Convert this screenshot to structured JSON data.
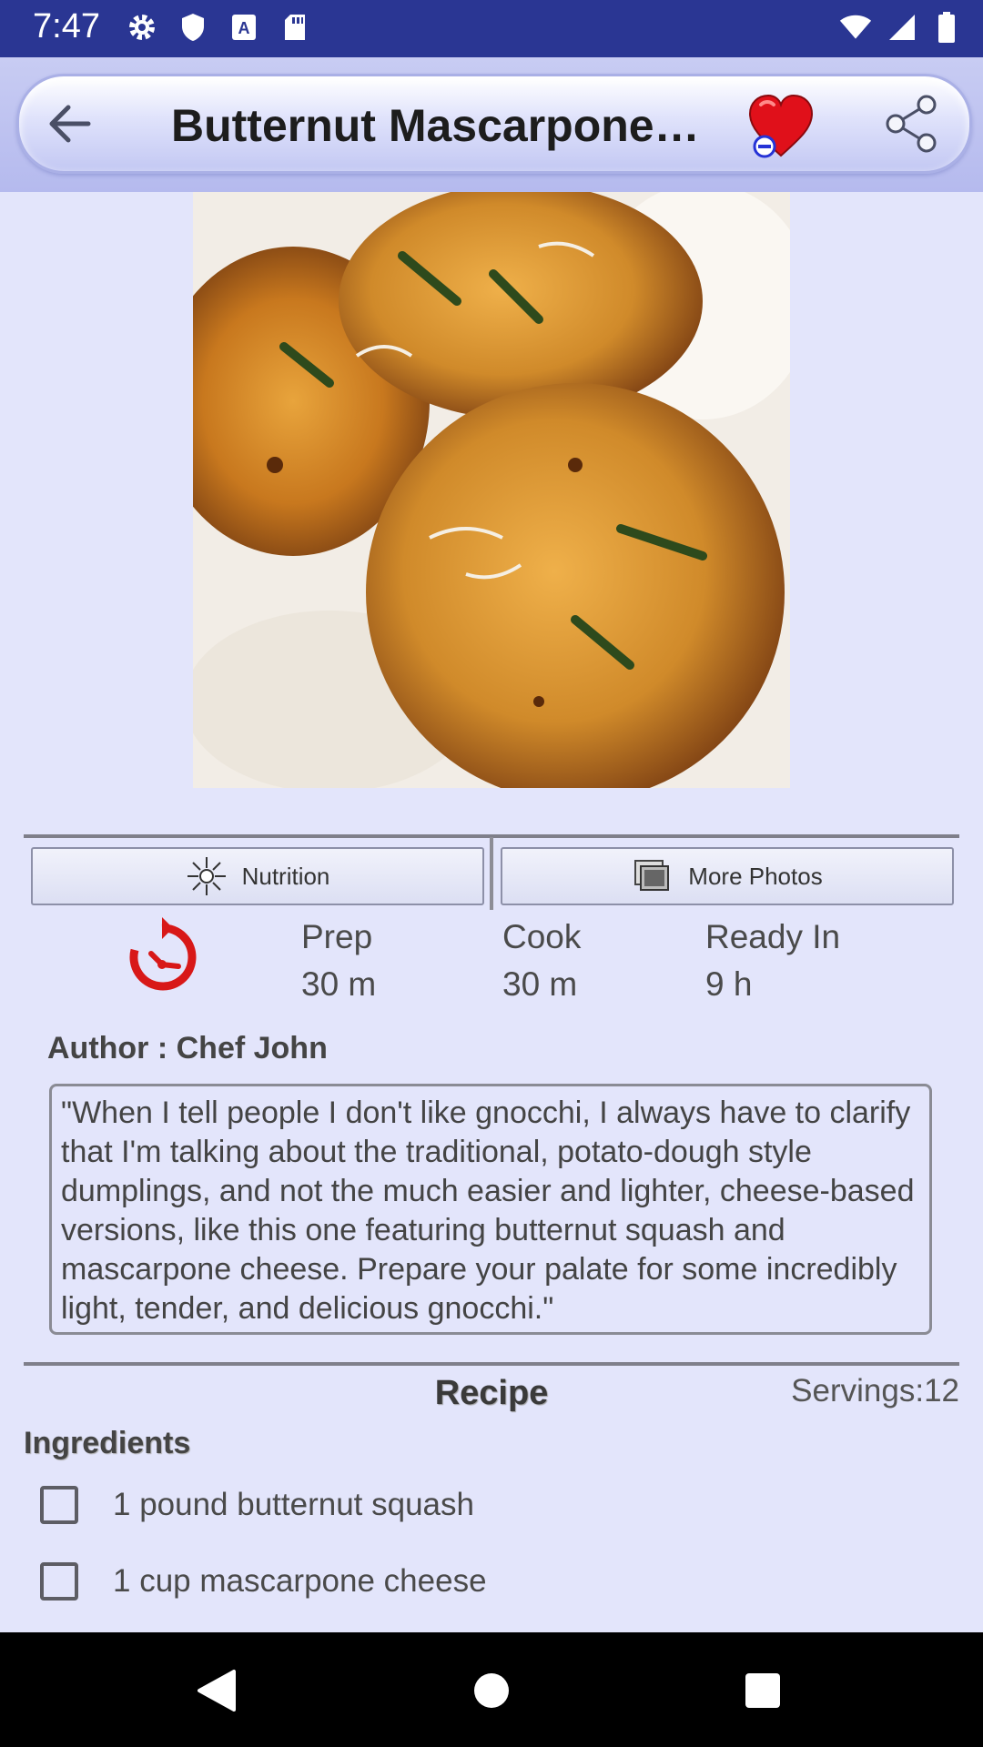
{
  "status_bar": {
    "time": "7:47",
    "left_icons": [
      "gear-icon",
      "shield-icon",
      "font-icon",
      "sd-card-icon"
    ],
    "right_icons": [
      "wifi-icon",
      "signal-icon",
      "battery-icon"
    ]
  },
  "app_bar": {
    "title": "Butternut Mascarpone…",
    "back_icon": "arrow-left-icon",
    "favorite_icon": "heart-icon",
    "share_icon": "share-icon"
  },
  "photo": {
    "description_icon": "gnocchi-photo"
  },
  "actions": {
    "nutrition_label": "Nutrition",
    "more_photos_label": "More Photos"
  },
  "times": {
    "prep_label": "Prep",
    "prep_value": "30 m",
    "cook_label": "Cook",
    "cook_value": "30 m",
    "ready_label": "Ready In",
    "ready_value": "9 h"
  },
  "author": "Author : Chef John",
  "description": "\"When I tell people I don't like gnocchi, I always have to clarify that I'm talking about the traditional, potato-dough style dumplings, and not the much easier and lighter, cheese-based versions, like this one featuring butternut squash and mascarpone cheese. Prepare your palate for some incredibly light, tender, and delicious gnocchi.\"",
  "recipe": {
    "heading": "Recipe",
    "servings": "Servings:12",
    "ingredients_title": "Ingredients",
    "ingredients": [
      {
        "text": "1 pound butternut squash",
        "checked": false
      },
      {
        "text": "1 cup mascarpone cheese",
        "checked": false
      }
    ]
  },
  "colors": {
    "status_bar": "#2a3693",
    "background": "#e3e5fb",
    "heart": "#e0101a",
    "timer": "#d81818"
  }
}
